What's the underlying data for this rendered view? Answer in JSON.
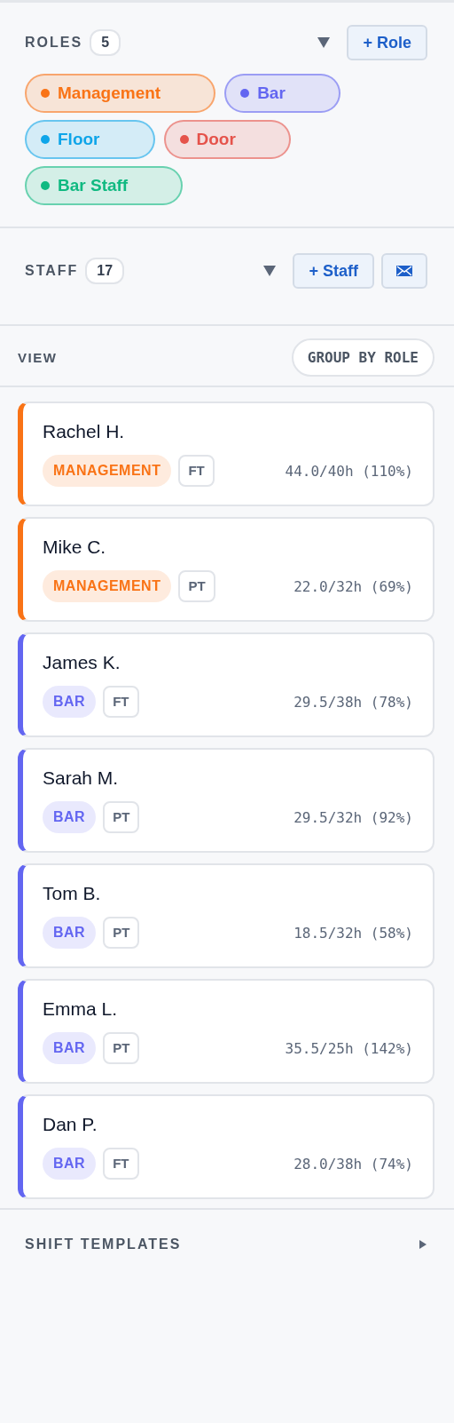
{
  "roles": {
    "title": "ROLES",
    "count": "5",
    "add_button": "+ Role",
    "expanded": true,
    "items": [
      {
        "label": "Management",
        "color": "#f97316"
      },
      {
        "label": "Bar",
        "color": "#6366f1"
      },
      {
        "label": "Floor",
        "color": "#0ea5e9"
      },
      {
        "label": "Door",
        "color": "#e5534b"
      },
      {
        "label": "Bar Staff",
        "color": "#10b981"
      }
    ]
  },
  "staff": {
    "title": "STAFF",
    "count": "17",
    "add_button": "+ Staff",
    "expanded": true
  },
  "view": {
    "label": "VIEW",
    "button": "GROUP BY ROLE"
  },
  "staff_list": [
    {
      "name": "Rachel H.",
      "role": "MANAGEMENT",
      "color": "#f97316",
      "type": "FT",
      "hours": "44.0/40h (110%)"
    },
    {
      "name": "Mike C.",
      "role": "MANAGEMENT",
      "color": "#f97316",
      "type": "PT",
      "hours": "22.0/32h (69%)"
    },
    {
      "name": "James K.",
      "role": "BAR",
      "color": "#6366f1",
      "type": "FT",
      "hours": "29.5/38h (78%)"
    },
    {
      "name": "Sarah M.",
      "role": "BAR",
      "color": "#6366f1",
      "type": "PT",
      "hours": "29.5/32h (92%)"
    },
    {
      "name": "Tom B.",
      "role": "BAR",
      "color": "#6366f1",
      "type": "PT",
      "hours": "18.5/32h (58%)"
    },
    {
      "name": "Emma L.",
      "role": "BAR",
      "color": "#6366f1",
      "type": "PT",
      "hours": "35.5/25h (142%)"
    },
    {
      "name": "Dan P.",
      "role": "BAR",
      "color": "#6366f1",
      "type": "FT",
      "hours": "28.0/38h (74%)"
    }
  ],
  "shift_templates": {
    "title": "SHIFT TEMPLATES",
    "expanded": false
  }
}
